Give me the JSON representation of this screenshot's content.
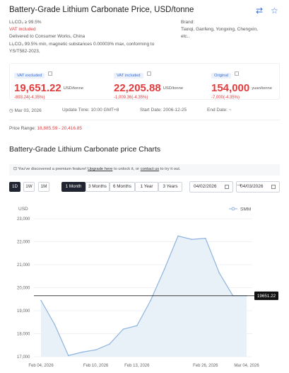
{
  "header": {
    "title": "Battery-Grade Lithium Carbonate Price, USD/tonne",
    "swap_icon": "swap-arrows-icon",
    "favorite_icon": "star-outline-icon"
  },
  "spec": {
    "formula_line": "Li₂CO₃ ≥ 99.5%",
    "vat_line": "VAT included",
    "delivery_line": "Delivered to Consumer Works, China",
    "standard_line1": "Li₂CO₃ 99.5% min, magnetic substances 0.00003% max, conforming to",
    "standard_line2": "YS/T582-2023,"
  },
  "brand": {
    "label": "Brand:",
    "names": "Tianqi, Ganfeng, Yongxing, Chengxin,",
    "more": "etc.."
  },
  "prices": [
    {
      "tag": "VAT excluded",
      "value": "19,651.22",
      "unit": "USD/tonne",
      "change": "-893.24(-4.35%)"
    },
    {
      "tag": "VAT included",
      "value": "22,205.88",
      "unit": "USD/tonne",
      "change": "-1,009.36(-4.35%)"
    },
    {
      "tag": "Original",
      "value": "154,000",
      "unit": "yuan/tonne",
      "change": "-7,000(-4.35%)"
    }
  ],
  "meta": {
    "date": "Mar 03, 2026",
    "update_time": "Update Time: 10:00 GMT+8",
    "start_date": "Start Date: 2006-12-25",
    "end_date": "End Date: ~"
  },
  "range": {
    "label": "Price Range:",
    "value": "18,885.59 - 20,416.85"
  },
  "chart_section": {
    "title": "Battery-Grade Lithium Carbonate price Charts",
    "notice_prefix": "You've discovered a premium feature!",
    "notice_link1": "Upgrade here",
    "notice_mid": " to unlock it, or ",
    "notice_link2": "contact us",
    "notice_suffix": " to try it out."
  },
  "controls": {
    "intervals": [
      "1D",
      "1W",
      "1M"
    ],
    "ranges": [
      "1 Month",
      "3 Months",
      "6 Months",
      "1 Year",
      "3 Years"
    ],
    "active_interval": "1D",
    "active_range": "1 Month",
    "date_from": "04/02/2026",
    "date_to": "04/03/2026",
    "arrow": "⇢"
  },
  "chart_data": {
    "type": "area",
    "ylabel": "USD",
    "legend": "SMM",
    "legend_position": "top-right",
    "y_ticks": [
      "23,000",
      "22,000",
      "21,000",
      "20,000",
      "19,000",
      "18,000",
      "17,000"
    ],
    "ylim": [
      17000,
      23000
    ],
    "x_ticks": [
      "Feb 04, 2026",
      "Feb 10, 2026",
      "Feb 13, 2026",
      "Feb 26, 2026",
      "Mar 04, 2026"
    ],
    "x": [
      "Feb 04",
      "Feb 05",
      "Feb 06",
      "Feb 09",
      "Feb 10",
      "Feb 11",
      "Feb 12",
      "Feb 13",
      "Feb 16",
      "Feb 23",
      "Feb 24",
      "Feb 25",
      "Feb 26",
      "Feb 27",
      "Mar 02",
      "Mar 03"
    ],
    "values": [
      19450,
      18400,
      17050,
      17200,
      17300,
      17550,
      18200,
      18350,
      19450,
      20800,
      22250,
      22100,
      22150,
      20650,
      19651.22,
      19651.22
    ],
    "current_value_label": "19651.22",
    "current_value": 19651.22,
    "colors": {
      "line": "#8fb3de",
      "fill": "#e8f0f8",
      "ref": "#222222"
    }
  }
}
